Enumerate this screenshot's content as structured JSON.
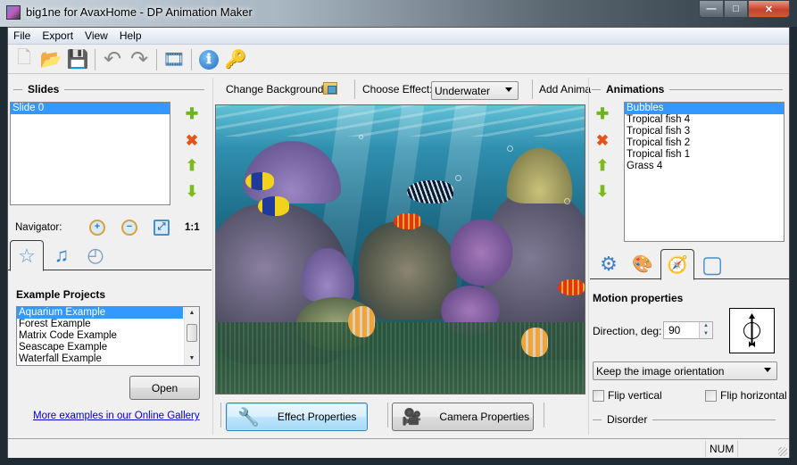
{
  "window": {
    "title": "big1ne for AvaxHome - DP Animation Maker",
    "controls": {
      "minimize": "—",
      "maximize": "□",
      "close": "✕"
    }
  },
  "menu": [
    "File",
    "Export",
    "View",
    "Help"
  ],
  "toolbar": {
    "buttons": [
      {
        "name": "new-icon",
        "glyph": "🗋"
      },
      {
        "name": "open-folder-icon",
        "glyph": "📂"
      },
      {
        "name": "save-icon",
        "glyph": "💾"
      },
      {
        "name": "undo-icon",
        "glyph": "↶"
      },
      {
        "name": "redo-icon",
        "glyph": "↷"
      },
      {
        "name": "export-video-icon",
        "glyph": "🎞"
      },
      {
        "name": "info-icon",
        "glyph": "ℹ"
      },
      {
        "name": "key-icon",
        "glyph": "🔑"
      }
    ]
  },
  "slides": {
    "title": "Slides",
    "items": [
      "Slide 0"
    ],
    "selected": 0,
    "actions": {
      "add": "✚",
      "delete": "✖",
      "up": "⬆",
      "down": "⬇"
    }
  },
  "navigator": {
    "label": "Navigator:",
    "zoom_in": "+",
    "zoom_out": "−",
    "fit": "⤢",
    "actual_size": "1:1"
  },
  "left_tabs": [
    {
      "name": "tab-favorites",
      "glyph": "☆"
    },
    {
      "name": "tab-music",
      "glyph": "♫"
    },
    {
      "name": "tab-timing",
      "glyph": "◴"
    }
  ],
  "examples": {
    "title": "Example Projects",
    "items": [
      "Aquarium Example",
      "Forest Example",
      "Matrix Code Example",
      "Seascape Example",
      "Waterfall Example"
    ],
    "selected": 0,
    "open_button": "Open",
    "gallery_link": "More examples in our Online Gallery"
  },
  "center": {
    "change_background": "Change Background",
    "choose_effect_label": "Choose Effect:",
    "effect_value": "Underwater",
    "add_animation": "Add Anima",
    "effect_properties": "Effect Properties",
    "camera_properties": "Camera Properties"
  },
  "animations": {
    "title": "Animations",
    "items": [
      "Bubbles",
      "Tropical fish 4",
      "Tropical fish 3",
      "Tropical fish 2",
      "Tropical fish 1",
      "Grass 4"
    ],
    "selected": 0
  },
  "right_tabs": [
    {
      "name": "tab-general-settings",
      "glyph": "⚙"
    },
    {
      "name": "tab-appearance",
      "glyph": "🎨"
    },
    {
      "name": "tab-motion",
      "glyph": "🧭"
    },
    {
      "name": "tab-bounds",
      "glyph": "▢"
    }
  ],
  "motion": {
    "title": "Motion properties",
    "direction_label": "Direction, deg:",
    "direction_value": "90",
    "orientation_value": "Keep the image orientation",
    "flip_vertical": "Flip vertical",
    "flip_vertical_checked": false,
    "flip_horizontal": "Flip horizontal",
    "flip_horizontal_checked": false,
    "disorder_label": "Disorder"
  },
  "status": {
    "num": "NUM"
  },
  "colors": {
    "selection": "#3399ff",
    "link": "#0000cc",
    "add": "#6cb51e",
    "delete": "#e5521b"
  }
}
